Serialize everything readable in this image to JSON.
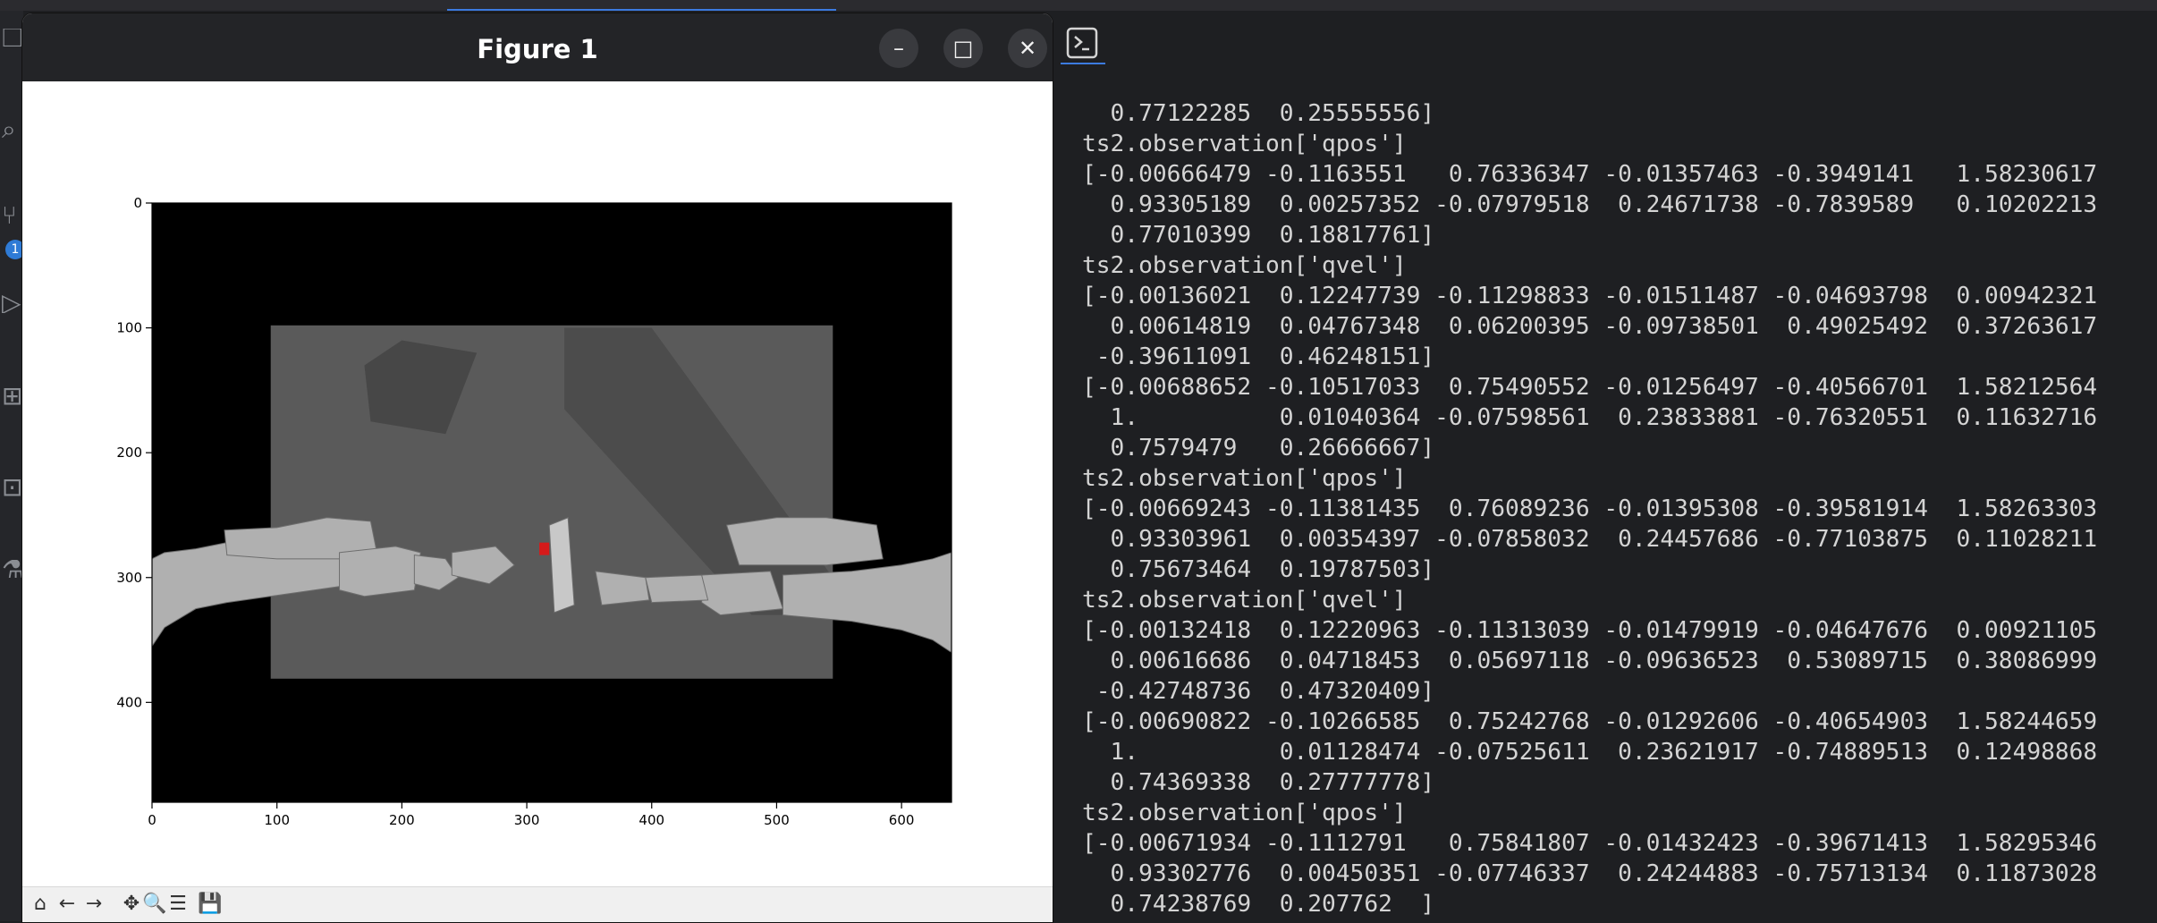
{
  "figure_window": {
    "title": "Figure 1",
    "minimize_glyph": "–",
    "maximize_glyph": "□",
    "close_glyph": "✕",
    "toolbar": [
      {
        "name": "home-icon",
        "glyph": "⌂"
      },
      {
        "name": "back-icon",
        "glyph": "←"
      },
      {
        "name": "forward-icon",
        "glyph": "→"
      },
      {
        "name": "pan-icon",
        "glyph": "✥"
      },
      {
        "name": "zoom-icon",
        "glyph": "🔍"
      },
      {
        "name": "configure-subplots-icon",
        "glyph": "☰"
      },
      {
        "name": "save-icon",
        "glyph": "💾"
      }
    ]
  },
  "chart_data": {
    "type": "image",
    "title": "",
    "xlabel": "",
    "ylabel": "",
    "xlim": [
      0,
      640
    ],
    "ylim": [
      480,
      0
    ],
    "x_ticks": [
      0,
      100,
      200,
      300,
      400,
      500,
      600
    ],
    "y_ticks": [
      0,
      100,
      200,
      300,
      400
    ],
    "x_tick_labels": [
      "0",
      "100",
      "200",
      "300",
      "400",
      "500",
      "600"
    ],
    "y_tick_labels": [
      "0",
      "100",
      "200",
      "300",
      "400"
    ],
    "image_description_colors": {
      "background": "#000000",
      "table": "#5a5a5a",
      "arms": "#b0b0b0",
      "target": "#d61a1a"
    }
  },
  "activity_bar": {
    "badge": "1"
  },
  "terminal": {
    "lines": [
      "  0.77122285  0.25555556]",
      "ts2.observation['qpos']",
      "[-0.00666479 -0.1163551   0.76336347 -0.01357463 -0.3949141   1.58230617",
      "  0.93305189  0.00257352 -0.07979518  0.24671738 -0.7839589   0.10202213",
      "  0.77010399  0.18817761]",
      "ts2.observation['qvel']",
      "[-0.00136021  0.12247739 -0.11298833 -0.01511487 -0.04693798  0.00942321",
      "  0.00614819  0.04767348  0.06200395 -0.09738501  0.49025492  0.37263617",
      " -0.39611091  0.46248151]",
      "[-0.00688652 -0.10517033  0.75490552 -0.01256497 -0.40566701  1.58212564",
      "  1.          0.01040364 -0.07598561  0.23833881 -0.76320551  0.11632716",
      "  0.7579479   0.26666667]",
      "ts2.observation['qpos']",
      "[-0.00669243 -0.11381435  0.76089236 -0.01395308 -0.39581914  1.58263303",
      "  0.93303961  0.00354397 -0.07858032  0.24457686 -0.77103875  0.11028211",
      "  0.75673464  0.19787503]",
      "ts2.observation['qvel']",
      "[-0.00132418  0.12220963 -0.11313039 -0.01479919 -0.04647676  0.00921105",
      "  0.00616686  0.04718453  0.05697118 -0.09636523  0.53089715  0.38086999",
      " -0.42748736  0.47320409]",
      "[-0.00690822 -0.10266585  0.75242768 -0.01292606 -0.40654903  1.58244659",
      "  1.          0.01128474 -0.07525611  0.23621917 -0.74889513  0.12498868",
      "  0.74369338  0.27777778]",
      "ts2.observation['qpos']",
      "[-0.00671934 -0.1112791   0.75841807 -0.01432423 -0.39671413  1.58295346",
      "  0.93302776  0.00450351 -0.07746337  0.24244883 -0.75713134  0.11873028",
      "  0.74238769  0.207762  ]"
    ]
  }
}
